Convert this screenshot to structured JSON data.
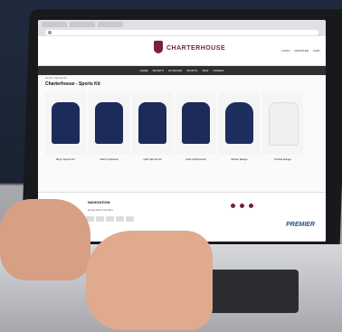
{
  "website": {
    "brand": "CHARTERHOUSE",
    "nav": [
      "HOME",
      "SPORTS",
      "OUTDOOR",
      "SPORTS",
      "NEW",
      "OFFERS"
    ],
    "breadcrumbs": "Home / Sports Kit",
    "title": "Charterhouse - Sports Kit",
    "products": [
      {
        "caption": "Boys Sports Kit"
      },
      {
        "caption": "Warm Optional"
      },
      {
        "caption": "Girls Sports Kit"
      },
      {
        "caption": "Girls Optional Kit"
      },
      {
        "caption": "Winter Range"
      },
      {
        "caption": "Cricket Range"
      }
    ],
    "footer": {
      "heading": "NAVIGATION",
      "links": "Home About Contact",
      "logo": "PREMIER"
    }
  }
}
